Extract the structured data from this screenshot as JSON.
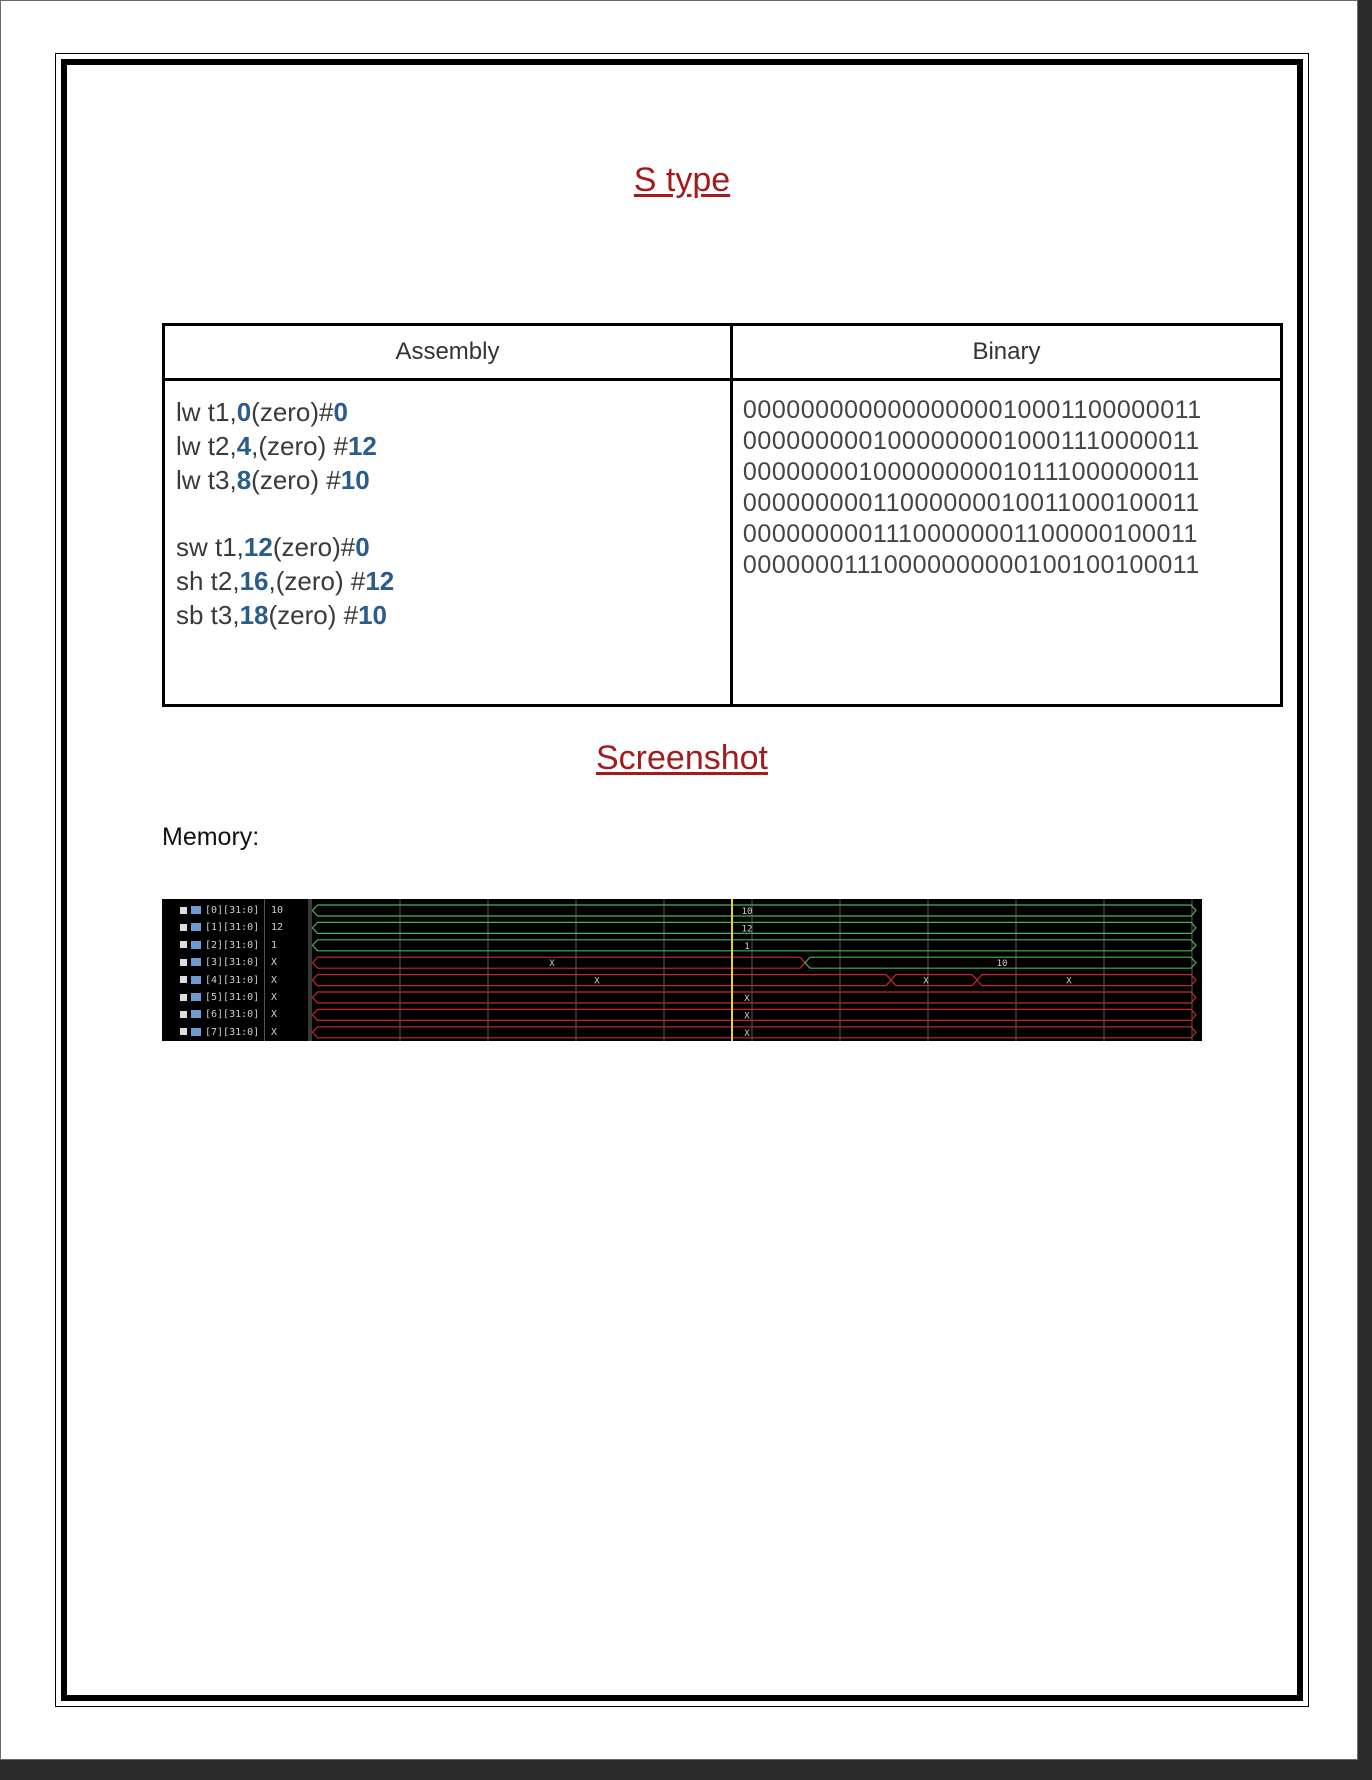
{
  "title": "S type",
  "table": {
    "header_assembly": "Assembly",
    "header_binary": "Binary",
    "assembly": [
      {
        "parts": [
          {
            "t": "lw t1,",
            "b": false
          },
          {
            "t": "0",
            "b": true
          },
          {
            "t": "(zero)#",
            "b": false
          },
          {
            "t": "0",
            "b": true
          }
        ]
      },
      {
        "parts": [
          {
            "t": "lw t2,",
            "b": false
          },
          {
            "t": "4",
            "b": true
          },
          {
            "t": ",(zero) #",
            "b": false
          },
          {
            "t": "12",
            "b": true
          }
        ]
      },
      {
        "parts": [
          {
            "t": "lw t3,",
            "b": false
          },
          {
            "t": "8",
            "b": true
          },
          {
            "t": "(zero) #",
            "b": false
          },
          {
            "t": "10",
            "b": true
          }
        ]
      },
      {
        "parts": []
      },
      {
        "parts": [
          {
            "t": "sw t1,",
            "b": false
          },
          {
            "t": "12",
            "b": true
          },
          {
            "t": "(zero)#",
            "b": false
          },
          {
            "t": "0",
            "b": true
          }
        ]
      },
      {
        "parts": [
          {
            "t": "sh t2,",
            "b": false
          },
          {
            "t": "16",
            "b": true
          },
          {
            "t": ",(zero) #",
            "b": false
          },
          {
            "t": "12",
            "b": true
          }
        ]
      },
      {
        "parts": [
          {
            "t": "sb t3,",
            "b": false
          },
          {
            "t": "18",
            "b": true
          },
          {
            "t": "(zero) #",
            "b": false
          },
          {
            "t": "10",
            "b": true
          }
        ]
      }
    ],
    "binary": [
      "00000000000000000010001100000011",
      "00000000010000000010001110000011",
      "00000000100000000010111000000011",
      "00000000011000000010011000100011",
      "00000000011100000001100000100011",
      "00000001110000000000100100100011"
    ]
  },
  "screenshot_heading": "Screenshot",
  "memory_label": "Memory:",
  "waveform": {
    "signals": [
      {
        "name": "[0][31:0]",
        "value": "10",
        "color": "#4caf50",
        "segments": [
          {
            "label": "10"
          }
        ]
      },
      {
        "name": "[1][31:0]",
        "value": "12",
        "color": "#4caf50",
        "segments": [
          {
            "label": "12"
          }
        ]
      },
      {
        "name": "[2][31:0]",
        "value": "1",
        "color": "#4caf50",
        "segments": [
          {
            "label": "1"
          }
        ]
      },
      {
        "name": "[3][31:0]",
        "value": "X",
        "color": "#c62828",
        "segments": [
          {
            "label": "X"
          },
          {
            "label": "10"
          }
        ]
      },
      {
        "name": "[4][31:0]",
        "value": "X",
        "color": "#c62828",
        "segments": [
          {
            "label": "X"
          },
          {
            "label": "X"
          },
          {
            "label": "X"
          }
        ]
      },
      {
        "name": "[5][31:0]",
        "value": "X",
        "color": "#c62828",
        "segments": [
          {
            "label": "X"
          }
        ]
      },
      {
        "name": "[6][31:0]",
        "value": "X",
        "color": "#c62828",
        "segments": [
          {
            "label": "X"
          }
        ]
      },
      {
        "name": "[7][31:0]",
        "value": "X",
        "color": "#c62828",
        "segments": [
          {
            "label": "X"
          }
        ]
      }
    ],
    "cursor_color": "#e6d23a",
    "grid_color": "#5a5a5a"
  }
}
